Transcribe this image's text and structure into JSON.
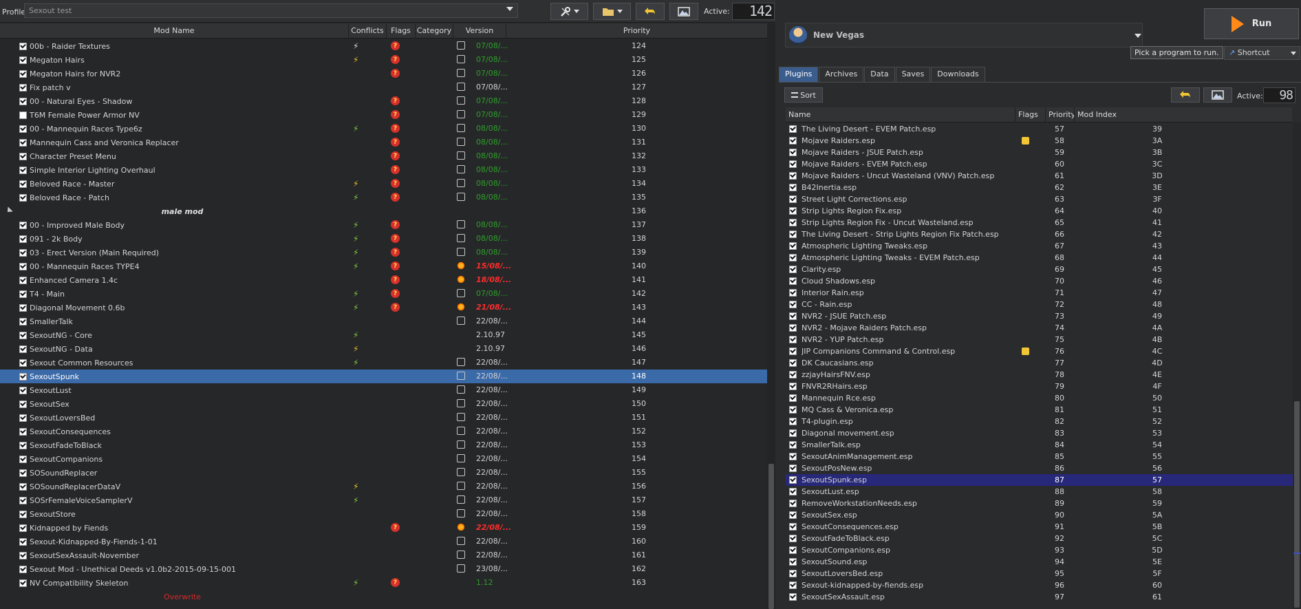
{
  "profile": {
    "label": "Profile",
    "value": "Sexout test"
  },
  "toolbar": {
    "active_label": "Active:",
    "active_count": "142"
  },
  "modlist": {
    "headers": [
      "Mod Name",
      "Conflicts",
      "Flags",
      "Category",
      "Version",
      "Priority"
    ],
    "rows": [
      {
        "checked": true,
        "name": "00b - Raider Textures",
        "conflict": "white",
        "flag": true,
        "vicon": "box",
        "version": "07/08/...",
        "vstyle": "green",
        "priority": "124"
      },
      {
        "checked": true,
        "name": "Megaton Hairs",
        "conflict": "yellow",
        "flag": true,
        "vicon": "box",
        "version": "07/08/...",
        "vstyle": "green",
        "priority": "125"
      },
      {
        "checked": true,
        "name": "Megaton Hairs for NVR2",
        "conflict": "",
        "flag": true,
        "vicon": "box",
        "version": "07/08/...",
        "vstyle": "green",
        "priority": "126"
      },
      {
        "checked": true,
        "name": "Fix patch v",
        "conflict": "",
        "flag": false,
        "vicon": "box",
        "version": "07/08/...",
        "vstyle": "norm",
        "priority": "127"
      },
      {
        "checked": true,
        "name": "00 - Natural Eyes - Shadow",
        "conflict": "",
        "flag": true,
        "vicon": "box",
        "version": "07/08/...",
        "vstyle": "green",
        "priority": "128"
      },
      {
        "checked": false,
        "name": "T6M Female Power Armor NV",
        "conflict": "",
        "flag": true,
        "vicon": "box",
        "version": "07/08/...",
        "vstyle": "green",
        "priority": "129"
      },
      {
        "checked": true,
        "name": "00 - Mannequin Races Type6z",
        "conflict": "green",
        "flag": true,
        "vicon": "box",
        "version": "08/08/...",
        "vstyle": "green",
        "priority": "130"
      },
      {
        "checked": true,
        "name": "Mannequin Cass and Veronica Replacer",
        "conflict": "",
        "flag": true,
        "vicon": "box",
        "version": "08/08/...",
        "vstyle": "green",
        "priority": "131"
      },
      {
        "checked": true,
        "name": "Character Preset Menu",
        "conflict": "",
        "flag": true,
        "vicon": "box",
        "version": "08/08/...",
        "vstyle": "green",
        "priority": "132"
      },
      {
        "checked": true,
        "name": "Simple Interior Lighting Overhaul",
        "conflict": "",
        "flag": true,
        "vicon": "box",
        "version": "08/08/...",
        "vstyle": "green",
        "priority": "133"
      },
      {
        "checked": true,
        "name": "Beloved Race - Master",
        "conflict": "yellow",
        "flag": true,
        "vicon": "box",
        "version": "08/08/...",
        "vstyle": "green",
        "priority": "134"
      },
      {
        "checked": true,
        "name": "Beloved Race - Patch",
        "conflict": "green",
        "flag": true,
        "vicon": "box",
        "version": "08/08/...",
        "vstyle": "green",
        "priority": "135"
      },
      {
        "separator": true,
        "name": "male mod",
        "priority": "136"
      },
      {
        "checked": true,
        "name": "00 - Improved Male Body",
        "conflict": "green",
        "flag": true,
        "vicon": "box",
        "version": "08/08/...",
        "vstyle": "green",
        "priority": "137"
      },
      {
        "checked": true,
        "name": "091 - 2k Body",
        "conflict": "green",
        "flag": true,
        "vicon": "box",
        "version": "08/08/...",
        "vstyle": "green",
        "priority": "138"
      },
      {
        "checked": true,
        "name": "03 - Erect Version (Main Required)",
        "conflict": "green",
        "flag": true,
        "vicon": "box",
        "version": "08/08/...",
        "vstyle": "green",
        "priority": "139"
      },
      {
        "checked": true,
        "name": "00 - Mannequin Races TYPE4",
        "conflict": "green",
        "flag": true,
        "vicon": "star",
        "version": "15/08/...",
        "vstyle": "red",
        "priority": "140"
      },
      {
        "checked": true,
        "name": "Enhanced Camera 1.4c",
        "conflict": "",
        "flag": true,
        "vicon": "star",
        "version": "18/08/...",
        "vstyle": "red",
        "priority": "141"
      },
      {
        "checked": true,
        "name": "T4 - Main",
        "conflict": "green",
        "flag": true,
        "vicon": "box",
        "version": "07/08/...",
        "vstyle": "green",
        "priority": "142"
      },
      {
        "checked": true,
        "name": "Diagonal Movement 0.6b",
        "conflict": "green",
        "flag": true,
        "vicon": "star",
        "version": "21/08/...",
        "vstyle": "red",
        "priority": "143"
      },
      {
        "checked": true,
        "name": "SmallerTalk",
        "conflict": "",
        "flag": false,
        "vicon": "box",
        "version": "22/08/...",
        "vstyle": "norm",
        "priority": "144"
      },
      {
        "checked": true,
        "name": "SexoutNG - Core",
        "conflict": "green",
        "flag": false,
        "vicon": "",
        "version": "2.10.97",
        "vstyle": "norm",
        "priority": "145"
      },
      {
        "checked": true,
        "name": "SexoutNG - Data",
        "conflict": "yellow",
        "flag": false,
        "vicon": "",
        "version": "2.10.97",
        "vstyle": "norm",
        "priority": "146"
      },
      {
        "checked": true,
        "name": "Sexout Common Resources",
        "conflict": "green",
        "flag": false,
        "vicon": "box",
        "version": "22/08/...",
        "vstyle": "norm",
        "priority": "147"
      },
      {
        "checked": true,
        "name": "SexoutSpunk",
        "conflict": "",
        "flag": false,
        "vicon": "box",
        "version": "22/08/...",
        "vstyle": "norm",
        "priority": "148",
        "selected": true
      },
      {
        "checked": true,
        "name": "SexoutLust",
        "conflict": "",
        "flag": false,
        "vicon": "box",
        "version": "22/08/...",
        "vstyle": "norm",
        "priority": "149"
      },
      {
        "checked": true,
        "name": "SexoutSex",
        "conflict": "",
        "flag": false,
        "vicon": "box",
        "version": "22/08/...",
        "vstyle": "norm",
        "priority": "150"
      },
      {
        "checked": true,
        "name": "SexoutLoversBed",
        "conflict": "",
        "flag": false,
        "vicon": "box",
        "version": "22/08/...",
        "vstyle": "norm",
        "priority": "151"
      },
      {
        "checked": true,
        "name": "SexoutConsequences",
        "conflict": "",
        "flag": false,
        "vicon": "box",
        "version": "22/08/...",
        "vstyle": "norm",
        "priority": "152"
      },
      {
        "checked": true,
        "name": "SexoutFadeToBlack",
        "conflict": "",
        "flag": false,
        "vicon": "box",
        "version": "22/08/...",
        "vstyle": "norm",
        "priority": "153"
      },
      {
        "checked": true,
        "name": "SexoutCompanions",
        "conflict": "",
        "flag": false,
        "vicon": "box",
        "version": "22/08/...",
        "vstyle": "norm",
        "priority": "154"
      },
      {
        "checked": true,
        "name": "SOSoundReplacer",
        "conflict": "",
        "flag": false,
        "vicon": "box",
        "version": "22/08/...",
        "vstyle": "norm",
        "priority": "155"
      },
      {
        "checked": true,
        "name": "SOSoundReplacerDataV",
        "conflict": "yellow",
        "flag": false,
        "vicon": "box",
        "version": "22/08/...",
        "vstyle": "norm",
        "priority": "156"
      },
      {
        "checked": true,
        "name": "SOSrFemaleVoiceSamplerV",
        "conflict": "green",
        "flag": false,
        "vicon": "box",
        "version": "22/08/...",
        "vstyle": "norm",
        "priority": "157"
      },
      {
        "checked": true,
        "name": "SexoutStore",
        "conflict": "",
        "flag": false,
        "vicon": "box",
        "version": "22/08/...",
        "vstyle": "norm",
        "priority": "158"
      },
      {
        "checked": true,
        "name": "Kidnapped by Fiends",
        "conflict": "",
        "flag": true,
        "vicon": "star",
        "version": "22/08/...",
        "vstyle": "red",
        "priority": "159"
      },
      {
        "checked": true,
        "name": "Sexout-Kidnapped-By-Fiends-1-01",
        "conflict": "",
        "flag": false,
        "vicon": "box",
        "version": "22/08/...",
        "vstyle": "norm",
        "priority": "160"
      },
      {
        "checked": true,
        "name": "SexoutSexAssault-November",
        "conflict": "",
        "flag": false,
        "vicon": "box",
        "version": "22/08/...",
        "vstyle": "norm",
        "priority": "161"
      },
      {
        "checked": true,
        "name": "Sexout Mod - Unethical Deeds v1.0b2-2015-09-15-001",
        "conflict": "",
        "flag": false,
        "vicon": "box",
        "version": "23/08/...",
        "vstyle": "norm",
        "priority": "162"
      },
      {
        "checked": true,
        "name": "NV Compatibility Skeleton",
        "conflict": "green",
        "flag": true,
        "vicon": "",
        "version": "1.12",
        "vstyle": "green",
        "priority": "163"
      },
      {
        "overwrite": true,
        "name": "Overwrite"
      }
    ]
  },
  "game": {
    "name": "New Vegas"
  },
  "run": {
    "label": "Run"
  },
  "tooltip": "Pick a program to run.",
  "shortcut": {
    "label": "Shortcut"
  },
  "tabs": [
    "Plugins",
    "Archives",
    "Data",
    "Saves",
    "Downloads"
  ],
  "plugins": {
    "sort_label": "Sort",
    "active_label": "Active:",
    "active_count": "98",
    "headers": [
      "Name",
      "Flags",
      "Priority",
      "Mod Index"
    ],
    "rows": [
      {
        "name": "The Living Desert - EVEM Patch.esp",
        "flag": false,
        "priority": "57",
        "index": "39"
      },
      {
        "name": "Mojave Raiders.esp",
        "flag": true,
        "priority": "58",
        "index": "3A"
      },
      {
        "name": "Mojave Raiders - JSUE Patch.esp",
        "flag": false,
        "priority": "59",
        "index": "3B"
      },
      {
        "name": "Mojave Raiders - EVEM Patch.esp",
        "flag": false,
        "priority": "60",
        "index": "3C"
      },
      {
        "name": "Mojave Raiders - Uncut Wasteland (VNV) Patch.esp",
        "flag": false,
        "priority": "61",
        "index": "3D"
      },
      {
        "name": "B42Inertia.esp",
        "flag": false,
        "priority": "62",
        "index": "3E"
      },
      {
        "name": "Street Light Corrections.esp",
        "flag": false,
        "priority": "63",
        "index": "3F"
      },
      {
        "name": "Strip Lights Region Fix.esp",
        "flag": false,
        "priority": "64",
        "index": "40"
      },
      {
        "name": "Strip Lights Region Fix - Uncut Wasteland.esp",
        "flag": false,
        "priority": "65",
        "index": "41"
      },
      {
        "name": "The Living Desert - Strip Lights Region Fix Patch.esp",
        "flag": false,
        "priority": "66",
        "index": "42"
      },
      {
        "name": "Atmospheric Lighting Tweaks.esp",
        "flag": false,
        "priority": "67",
        "index": "43"
      },
      {
        "name": "Atmospheric Lighting Tweaks - EVEM Patch.esp",
        "flag": false,
        "priority": "68",
        "index": "44"
      },
      {
        "name": "Clarity.esp",
        "flag": false,
        "priority": "69",
        "index": "45"
      },
      {
        "name": "Cloud Shadows.esp",
        "flag": false,
        "priority": "70",
        "index": "46"
      },
      {
        "name": "Interior Rain.esp",
        "flag": false,
        "priority": "71",
        "index": "47"
      },
      {
        "name": "CC - Rain.esp",
        "flag": false,
        "priority": "72",
        "index": "48"
      },
      {
        "name": "NVR2 - JSUE Patch.esp",
        "flag": false,
        "priority": "73",
        "index": "49"
      },
      {
        "name": "NVR2 - Mojave Raiders Patch.esp",
        "flag": false,
        "priority": "74",
        "index": "4A"
      },
      {
        "name": "NVR2 - YUP Patch.esp",
        "flag": false,
        "priority": "75",
        "index": "4B"
      },
      {
        "name": "JIP Companions Command & Control.esp",
        "flag": true,
        "priority": "76",
        "index": "4C"
      },
      {
        "name": "DK Caucasians.esp",
        "flag": false,
        "priority": "77",
        "index": "4D"
      },
      {
        "name": "zzjayHairsFNV.esp",
        "flag": false,
        "priority": "78",
        "index": "4E"
      },
      {
        "name": "FNVR2RHairs.esp",
        "flag": false,
        "priority": "79",
        "index": "4F"
      },
      {
        "name": "Mannequin Rce.esp",
        "flag": false,
        "priority": "80",
        "index": "50"
      },
      {
        "name": "MQ Cass & Veronica.esp",
        "flag": false,
        "priority": "81",
        "index": "51"
      },
      {
        "name": "T4-plugin.esp",
        "flag": false,
        "priority": "82",
        "index": "52"
      },
      {
        "name": "Diagonal movement.esp",
        "flag": false,
        "priority": "83",
        "index": "53"
      },
      {
        "name": "SmallerTalk.esp",
        "flag": false,
        "priority": "84",
        "index": "54"
      },
      {
        "name": "SexoutAnimManagement.esp",
        "flag": false,
        "priority": "85",
        "index": "55"
      },
      {
        "name": "SexoutPosNew.esp",
        "flag": false,
        "priority": "86",
        "index": "56"
      },
      {
        "name": "SexoutSpunk.esp",
        "flag": false,
        "priority": "87",
        "index": "57",
        "selected": true
      },
      {
        "name": "SexoutLust.esp",
        "flag": false,
        "priority": "88",
        "index": "58"
      },
      {
        "name": "RemoveWorkstationNeeds.esp",
        "flag": false,
        "priority": "89",
        "index": "59"
      },
      {
        "name": "SexoutSex.esp",
        "flag": false,
        "priority": "90",
        "index": "5A"
      },
      {
        "name": "SexoutConsequences.esp",
        "flag": false,
        "priority": "91",
        "index": "5B"
      },
      {
        "name": "SexoutFadeToBlack.esp",
        "flag": false,
        "priority": "92",
        "index": "5C"
      },
      {
        "name": "SexoutCompanions.esp",
        "flag": false,
        "priority": "93",
        "index": "5D"
      },
      {
        "name": "SexoutSound.esp",
        "flag": false,
        "priority": "94",
        "index": "5E"
      },
      {
        "name": "SexoutLoversBed.esp",
        "flag": false,
        "priority": "95",
        "index": "5F"
      },
      {
        "name": "Sexout-kidnapped-by-fiends.esp",
        "flag": false,
        "priority": "96",
        "index": "60"
      },
      {
        "name": "SexoutSexAssault.esp",
        "flag": false,
        "priority": "97",
        "index": "61"
      }
    ]
  }
}
